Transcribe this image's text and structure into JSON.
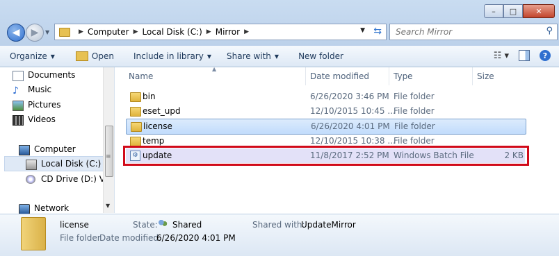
{
  "window": {
    "caption_min": "–",
    "caption_max": "□",
    "caption_close": "✕"
  },
  "address": {
    "crumbs": [
      "Computer",
      "Local Disk (C:)",
      "Mirror"
    ],
    "search_placeholder": "Search Mirror"
  },
  "toolbar": {
    "organize": "Organize",
    "open": "Open",
    "include": "Include in library",
    "share": "Share with",
    "new_folder": "New folder"
  },
  "nav": {
    "items": [
      {
        "label": "Documents",
        "icon": "documents-icon"
      },
      {
        "label": "Music",
        "icon": "music-icon"
      },
      {
        "label": "Pictures",
        "icon": "pictures-icon"
      },
      {
        "label": "Videos",
        "icon": "videos-icon"
      },
      {
        "label": "Computer",
        "icon": "computer-icon"
      },
      {
        "label": "Local Disk (C:)",
        "icon": "local-disk-icon"
      },
      {
        "label": "CD Drive (D:) Virt",
        "icon": "cd-drive-icon"
      },
      {
        "label": "Network",
        "icon": "network-icon"
      }
    ]
  },
  "columns": {
    "name": "Name",
    "date": "Date modified",
    "type": "Type",
    "size": "Size"
  },
  "files": [
    {
      "name": "bin",
      "date": "6/26/2020 3:46 PM",
      "type": "File folder",
      "size": ""
    },
    {
      "name": "eset_upd",
      "date": "12/10/2015 10:45 ...",
      "type": "File folder",
      "size": ""
    },
    {
      "name": "license",
      "date": "6/26/2020 4:01 PM",
      "type": "File folder",
      "size": ""
    },
    {
      "name": "temp",
      "date": "12/10/2015 10:38 ...",
      "type": "File folder",
      "size": ""
    },
    {
      "name": "update",
      "date": "11/8/2017 2:52 PM",
      "type": "Windows Batch File",
      "size": "2 KB"
    }
  ],
  "details": {
    "name": "license",
    "type": "File folder",
    "state_label": "State:",
    "state_value": "Shared",
    "shared_label": "Shared with:",
    "shared_value": "UpdateMirror",
    "date_label": "Date modified:",
    "date_value": "6/26/2020 4:01 PM"
  },
  "colors": {
    "highlight_box": "#d10a1a",
    "selection": "#c1dcfc"
  }
}
